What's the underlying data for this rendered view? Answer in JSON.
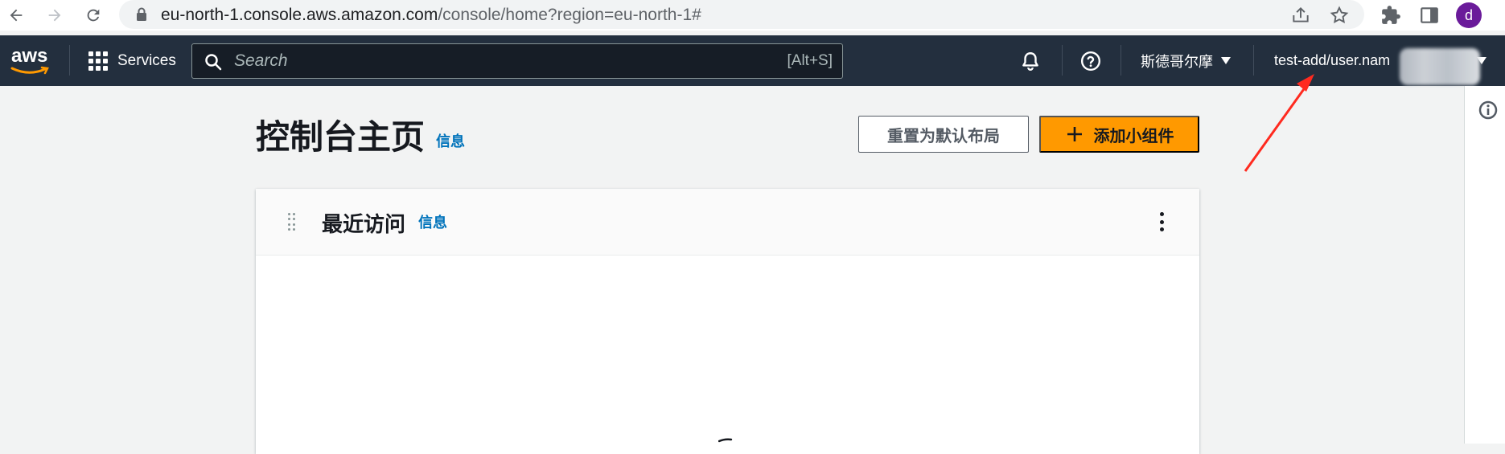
{
  "browser": {
    "url_host": "eu-north-1.console.aws.amazon.com",
    "url_path": "/console/home?region=eu-north-1#",
    "profile_initial": "d"
  },
  "aws_nav": {
    "logo_text": "aws",
    "services_label": "Services",
    "search_placeholder": "Search",
    "search_shortcut": "[Alt+S]",
    "region_label": "斯德哥尔摩",
    "account_label": "test-add/user.nam"
  },
  "main": {
    "page_title": "控制台主页",
    "page_title_info": "信息",
    "reset_button_label": "重置为默认布局",
    "add_widget_button_label": "添加小组件"
  },
  "widget": {
    "title": "最近访问",
    "info_label": "信息"
  },
  "colors": {
    "aws_nav_bg": "#232f3e",
    "accent_orange": "#ff9900",
    "link_blue": "#0073bb",
    "annotation_red": "#ff2a1f"
  }
}
